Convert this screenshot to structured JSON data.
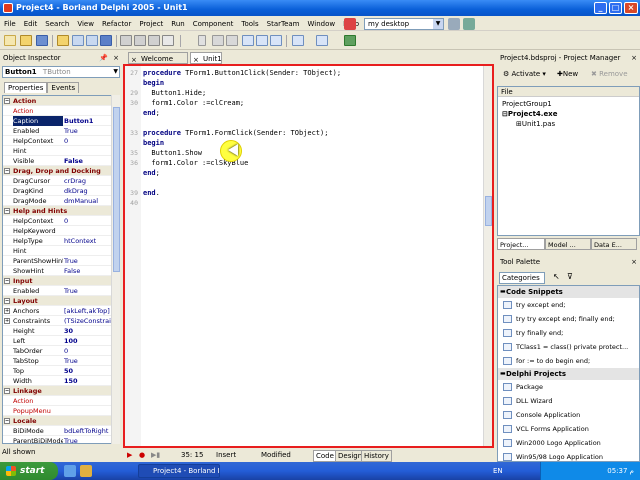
{
  "window": {
    "title": "Project4 - Borland Delphi 2005 - Unit1"
  },
  "menu": [
    "File",
    "Edit",
    "Search",
    "View",
    "Refactor",
    "Project",
    "Run",
    "Component",
    "Tools",
    "StarTeam",
    "Window",
    "Help"
  ],
  "layout_combo": "my desktop",
  "object_inspector": {
    "title": "Object Inspector",
    "selected_object": "Button1",
    "selected_type": "TButton",
    "tabs": [
      "Properties",
      "Events"
    ],
    "rows": [
      {
        "cat": true,
        "name": "Action"
      },
      {
        "name": "Action",
        "value": "",
        "red": true
      },
      {
        "name": "Caption",
        "value": "Button1",
        "sel": true,
        "bold": true
      },
      {
        "name": "Enabled",
        "value": "True"
      },
      {
        "name": "HelpContext",
        "value": "0"
      },
      {
        "name": "Hint",
        "value": ""
      },
      {
        "name": "Visible",
        "value": "False",
        "bold": true
      },
      {
        "cat": true,
        "name": "Drag, Drop and Docking"
      },
      {
        "name": "DragCursor",
        "value": "crDrag"
      },
      {
        "name": "DragKind",
        "value": "dkDrag"
      },
      {
        "name": "DragMode",
        "value": "dmManual"
      },
      {
        "cat": true,
        "name": "Help and Hints"
      },
      {
        "name": "HelpContext",
        "value": "0"
      },
      {
        "name": "HelpKeyword",
        "value": ""
      },
      {
        "name": "HelpType",
        "value": "htContext"
      },
      {
        "name": "Hint",
        "value": ""
      },
      {
        "name": "ParentShowHint",
        "value": "True"
      },
      {
        "name": "ShowHint",
        "value": "False"
      },
      {
        "cat": true,
        "name": "Input"
      },
      {
        "name": "Enabled",
        "value": "True"
      },
      {
        "cat": true,
        "name": "Layout"
      },
      {
        "name": "Anchors",
        "value": "[akLeft,akTop]",
        "box": "+"
      },
      {
        "name": "Constraints",
        "value": "(TSizeConstrain",
        "box": "+"
      },
      {
        "name": "Height",
        "value": "30",
        "bold": true
      },
      {
        "name": "Left",
        "value": "100",
        "bold": true
      },
      {
        "name": "TabOrder",
        "value": "0"
      },
      {
        "name": "TabStop",
        "value": "True"
      },
      {
        "name": "Top",
        "value": "50",
        "bold": true
      },
      {
        "name": "Width",
        "value": "150",
        "bold": true
      },
      {
        "cat": true,
        "name": "Linkage"
      },
      {
        "name": "Action",
        "value": "",
        "red": true
      },
      {
        "name": "PopupMenu",
        "value": "",
        "red": true
      },
      {
        "cat": true,
        "name": "Locale"
      },
      {
        "name": "BiDiMode",
        "value": "bdLeftToRight"
      },
      {
        "name": "ParentBiDiMode",
        "value": "True"
      }
    ],
    "status": "All shown"
  },
  "editor": {
    "tabs": [
      "Welcome Page",
      "Unit1"
    ],
    "lines": [
      {
        "n": "27",
        "text": "procedure TForm1.Button1Click(Sender: TObject);"
      },
      {
        "n": "",
        "text": "begin"
      },
      {
        "n": "29",
        "text": "  Button1.Hide;"
      },
      {
        "n": "30",
        "text": "  form1.Color :=clCream;"
      },
      {
        "n": "",
        "text": "end;"
      },
      {
        "n": "",
        "text": ""
      },
      {
        "n": "33",
        "text": "procedure TForm1.FormClick(Sender: TObject);"
      },
      {
        "n": "",
        "text": "begin"
      },
      {
        "n": "35",
        "text": "  Button1.Show"
      },
      {
        "n": "36",
        "text": "  form1.Color :=clSkyBlue"
      },
      {
        "n": "",
        "text": "end;"
      },
      {
        "n": "",
        "text": ""
      },
      {
        "n": "39",
        "text": "end."
      },
      {
        "n": "40",
        "text": ""
      }
    ],
    "status": {
      "pos": "35: 15",
      "mode": "Insert",
      "state": "Modified",
      "tabs": [
        "Code",
        "Design",
        "History"
      ]
    }
  },
  "project_manager": {
    "title": "Project4.bdsproj - Project Manager",
    "buttons": [
      "Activate",
      "New",
      "Remove"
    ],
    "header": "File",
    "tree": [
      "ProjectGroup1",
      "Project4.exe",
      "Unit1.pas"
    ]
  },
  "right_tabs": [
    "Project...",
    "Model ...",
    "Data E..."
  ],
  "tool_palette": {
    "title": "Tool Palette",
    "categories_label": "Categories",
    "groups": [
      {
        "name": "Code Snippets",
        "items": [
          "try except end;",
          "try  try  except  end; finally end;",
          "try finally end;",
          "TClass1 = class() private protect...",
          "for := to do begin end;"
        ]
      },
      {
        "name": "Delphi Projects",
        "items": [
          "Package",
          "DLL Wizard",
          "Console Application",
          "VCL Forms Application",
          "Win2000 Logo Application",
          "Win95/98 Logo Application"
        ]
      }
    ]
  },
  "taskbar": {
    "start": "start",
    "task": "Project4 - Borland Delp...",
    "lang": "EN",
    "clock": "05:37 م"
  }
}
